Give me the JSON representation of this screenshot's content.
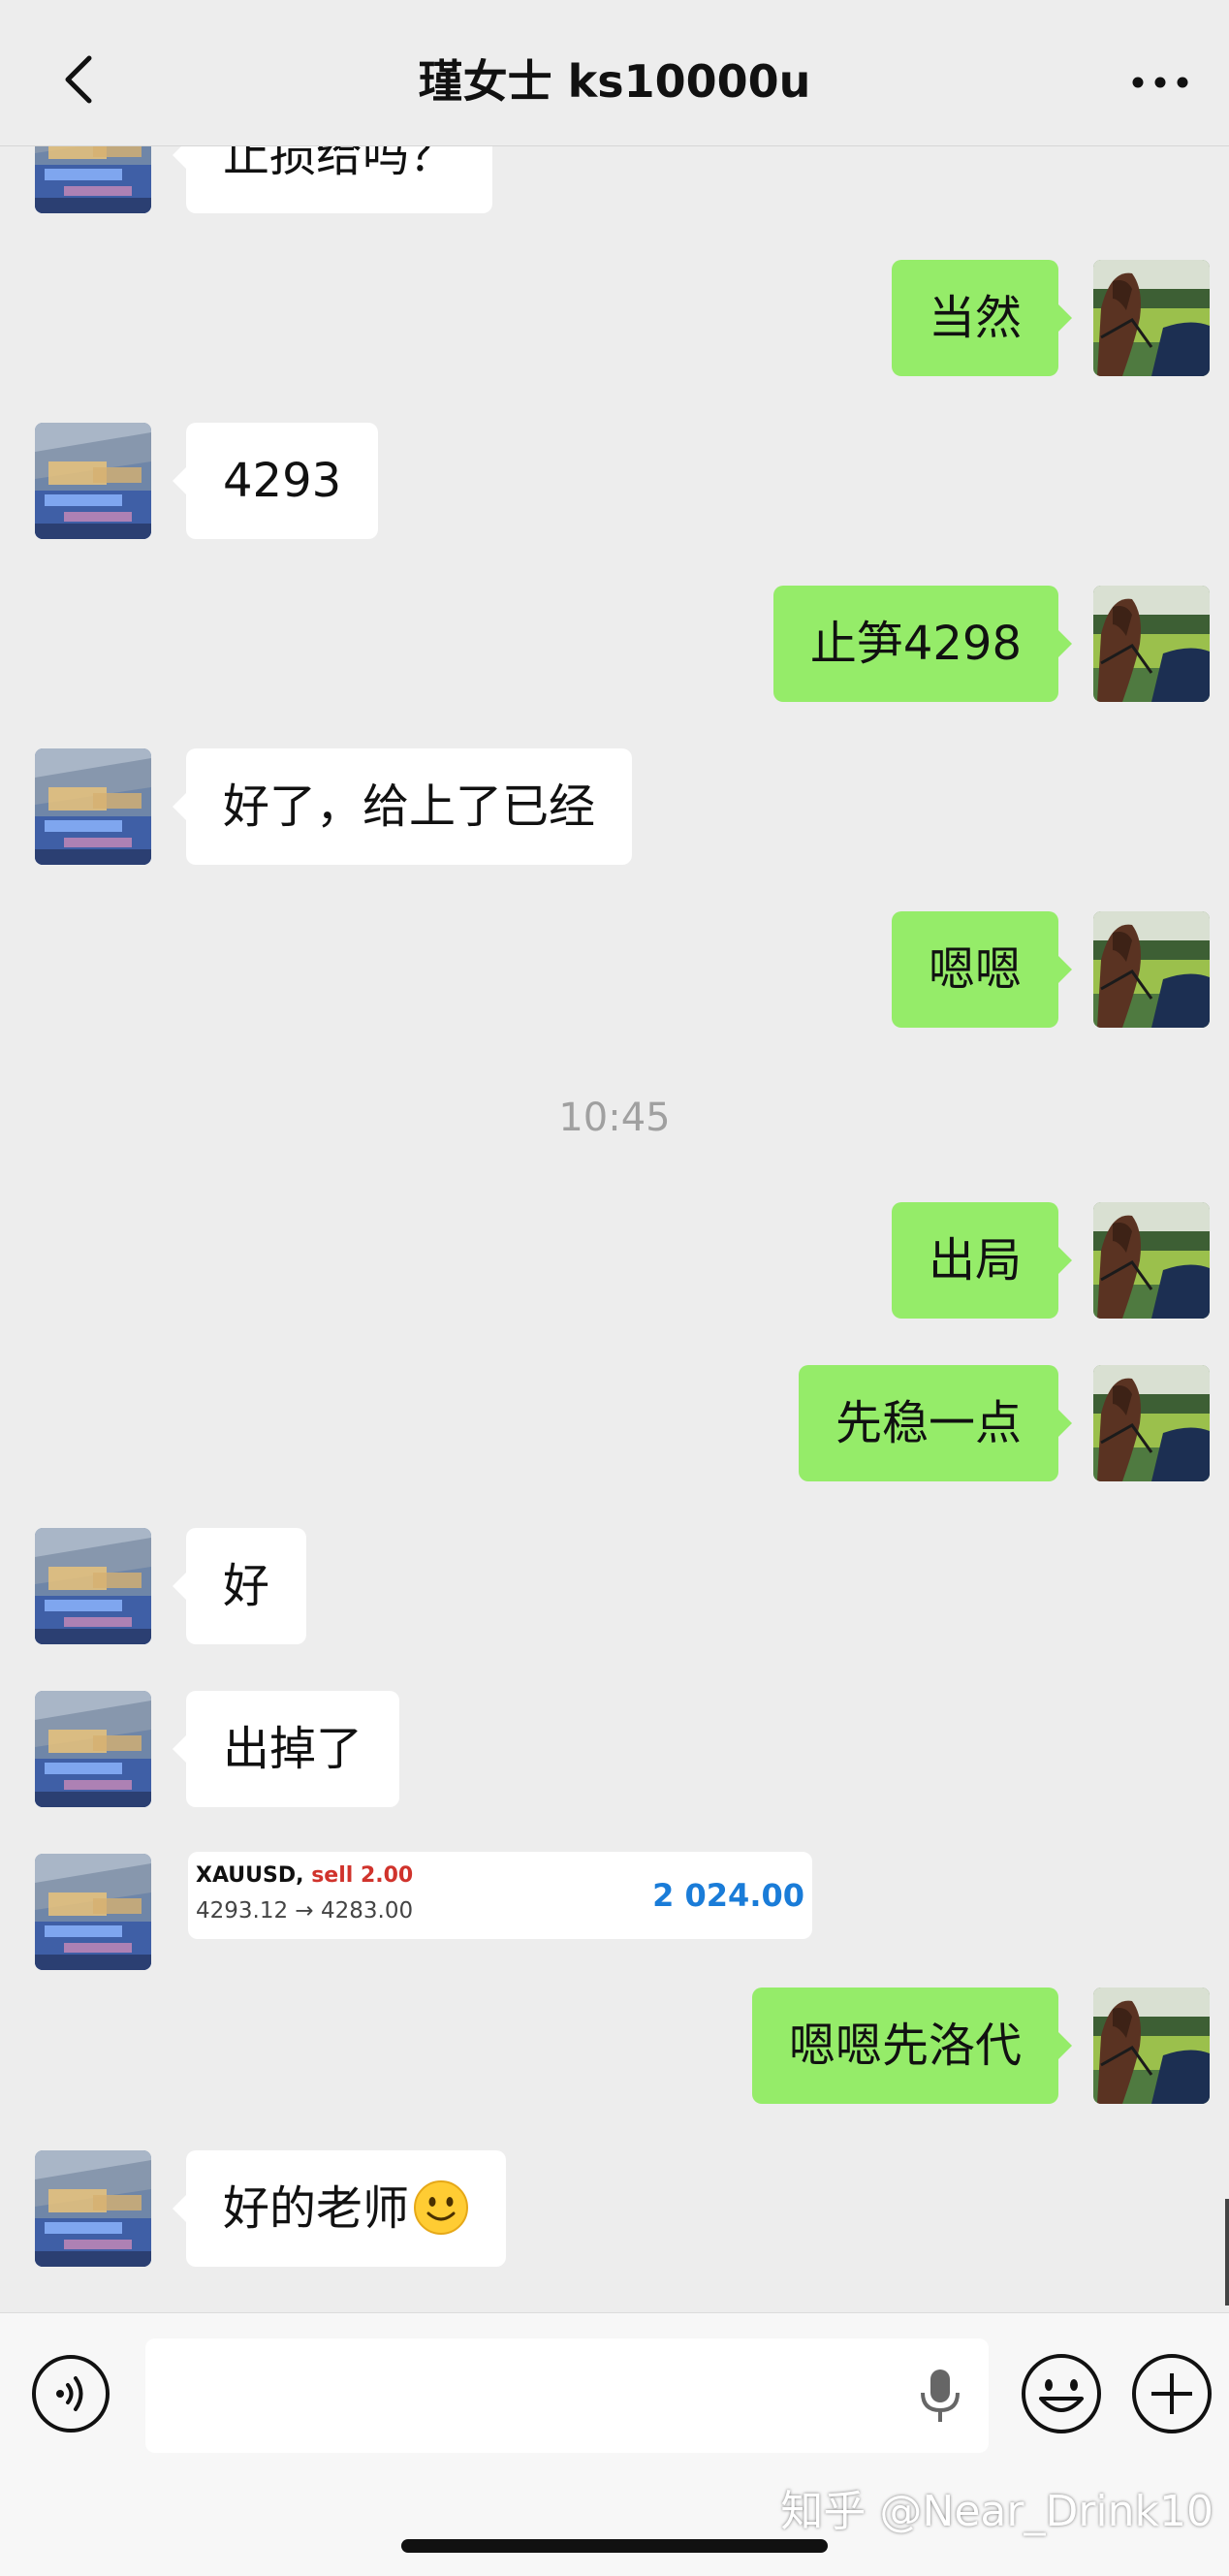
{
  "header": {
    "title": "瑾女士 ks10000u"
  },
  "messages": [
    {
      "side": "left",
      "text": "止损给吗？"
    },
    {
      "side": "right",
      "text": "当然"
    },
    {
      "side": "left",
      "text": "4293"
    },
    {
      "side": "right",
      "text": "止笋4298"
    },
    {
      "side": "left",
      "text": "好了，给上了已经"
    },
    {
      "side": "right",
      "text": "嗯嗯"
    },
    {
      "side": "right",
      "text": "出局"
    },
    {
      "side": "right",
      "text": "先稳一点"
    },
    {
      "side": "left",
      "text": "好"
    },
    {
      "side": "left",
      "text": "出掉了"
    },
    {
      "side": "right",
      "text": "嗯嗯先洛代"
    },
    {
      "side": "left",
      "text": "好的老师",
      "emoji": "slightly-smiling-face"
    }
  ],
  "timestamp": "10:45",
  "trade_card": {
    "symbol": "XAUUSD",
    "side": "sell 2.00",
    "prices": "4293.12 → 4283.00",
    "profit": "2 024.00",
    "colors": {
      "side": "#d0332c",
      "profit": "#1a7cd8"
    }
  },
  "input_bar": {
    "value": ""
  },
  "watermark": "知乎 @Near_Drink10",
  "colors": {
    "sent_bubble": "#95ec69",
    "received_bubble": "#ffffff",
    "background": "#ededed"
  },
  "icons": [
    "back-arrow-icon",
    "more-dots-icon",
    "voice-icon",
    "microphone-icon",
    "emoji-icon",
    "plus-icon"
  ]
}
